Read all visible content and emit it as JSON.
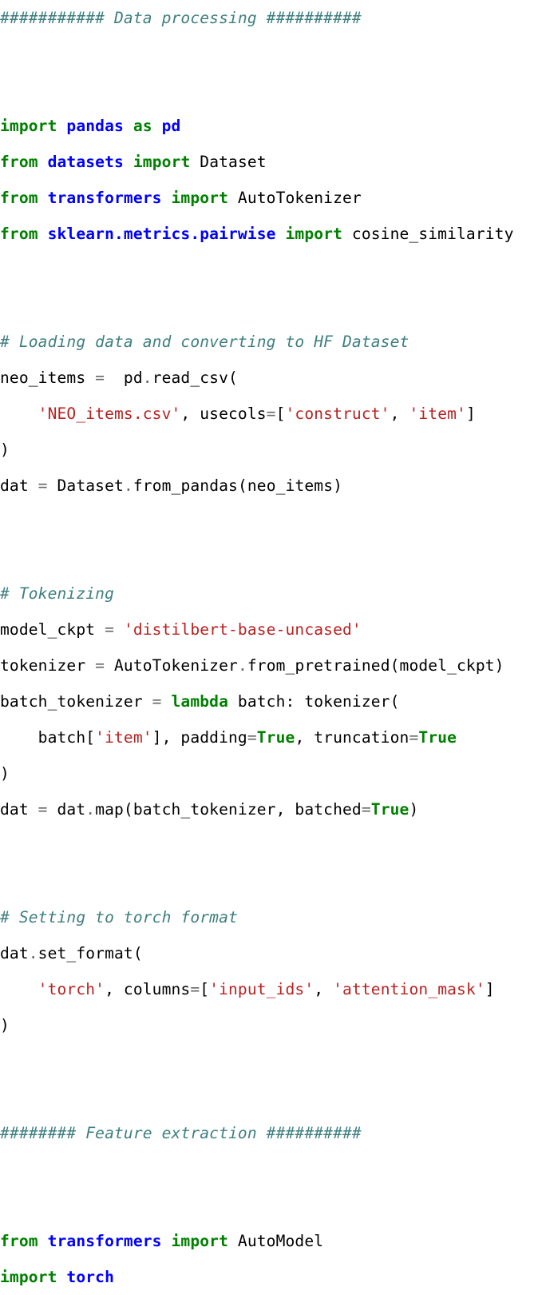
{
  "document": {
    "kind": "python-source-listing",
    "language": "Python",
    "background_color": "#ffffff",
    "default_text_color": "#000000"
  },
  "theme": {
    "comment_color": "#3f7f7f",
    "keyword_color": "#008000",
    "builtin_color": "#008000",
    "module_color": "#0000ff",
    "string_color": "#ba2121",
    "operator_color": "#666666",
    "plain_color": "#000000"
  },
  "sections": [
    {
      "id": "data-processing",
      "heading": "########### Data processing ##########"
    },
    {
      "id": "feature-extraction",
      "heading": "######## Feature extraction ##########"
    }
  ],
  "lines": [
    {
      "id": "l1",
      "kind": "comment",
      "tokens": [
        {
          "t": "comment",
          "v": "########### Data processing ##########"
        }
      ]
    },
    {
      "id": "l2",
      "kind": "blank",
      "tokens": []
    },
    {
      "id": "l3",
      "kind": "blank",
      "tokens": []
    },
    {
      "id": "l4",
      "kind": "code",
      "tokens": [
        {
          "t": "keyword",
          "v": "import"
        },
        {
          "t": "plain",
          "v": " "
        },
        {
          "t": "module",
          "v": "pandas"
        },
        {
          "t": "plain",
          "v": " "
        },
        {
          "t": "keyword",
          "v": "as"
        },
        {
          "t": "plain",
          "v": " "
        },
        {
          "t": "module",
          "v": "pd"
        }
      ]
    },
    {
      "id": "l5",
      "kind": "code",
      "tokens": [
        {
          "t": "keyword",
          "v": "from"
        },
        {
          "t": "plain",
          "v": " "
        },
        {
          "t": "module",
          "v": "datasets"
        },
        {
          "t": "plain",
          "v": " "
        },
        {
          "t": "keyword",
          "v": "import"
        },
        {
          "t": "plain",
          "v": " Dataset"
        }
      ]
    },
    {
      "id": "l6",
      "kind": "code",
      "tokens": [
        {
          "t": "keyword",
          "v": "from"
        },
        {
          "t": "plain",
          "v": " "
        },
        {
          "t": "module",
          "v": "transformers"
        },
        {
          "t": "plain",
          "v": " "
        },
        {
          "t": "keyword",
          "v": "import"
        },
        {
          "t": "plain",
          "v": " AutoTokenizer"
        }
      ]
    },
    {
      "id": "l7",
      "kind": "code",
      "tokens": [
        {
          "t": "keyword",
          "v": "from"
        },
        {
          "t": "plain",
          "v": " "
        },
        {
          "t": "module",
          "v": "sklearn.metrics.pairwise"
        },
        {
          "t": "plain",
          "v": " "
        },
        {
          "t": "keyword",
          "v": "import"
        },
        {
          "t": "plain",
          "v": " cosine_similarity"
        }
      ]
    },
    {
      "id": "l8",
      "kind": "blank",
      "tokens": []
    },
    {
      "id": "l9",
      "kind": "blank",
      "tokens": []
    },
    {
      "id": "l10",
      "kind": "comment",
      "tokens": [
        {
          "t": "comment",
          "v": "# Loading data and converting to HF Dataset"
        }
      ]
    },
    {
      "id": "l11",
      "kind": "code",
      "tokens": [
        {
          "t": "plain",
          "v": "neo_items "
        },
        {
          "t": "operator",
          "v": "="
        },
        {
          "t": "plain",
          "v": "  pd"
        },
        {
          "t": "operator",
          "v": "."
        },
        {
          "t": "plain",
          "v": "read_csv("
        }
      ]
    },
    {
      "id": "l12",
      "kind": "code",
      "tokens": [
        {
          "t": "plain",
          "v": "    "
        },
        {
          "t": "string",
          "v": "'NEO_items.csv'"
        },
        {
          "t": "plain",
          "v": ", usecols"
        },
        {
          "t": "operator",
          "v": "="
        },
        {
          "t": "plain",
          "v": "["
        },
        {
          "t": "string",
          "v": "'construct'"
        },
        {
          "t": "plain",
          "v": ", "
        },
        {
          "t": "string",
          "v": "'item'"
        },
        {
          "t": "plain",
          "v": "]"
        }
      ]
    },
    {
      "id": "l13",
      "kind": "code",
      "tokens": [
        {
          "t": "plain",
          "v": ")"
        }
      ]
    },
    {
      "id": "l14",
      "kind": "code",
      "tokens": [
        {
          "t": "plain",
          "v": "dat "
        },
        {
          "t": "operator",
          "v": "="
        },
        {
          "t": "plain",
          "v": " Dataset"
        },
        {
          "t": "operator",
          "v": "."
        },
        {
          "t": "plain",
          "v": "from_pandas(neo_items)"
        }
      ]
    },
    {
      "id": "l15",
      "kind": "blank",
      "tokens": []
    },
    {
      "id": "l16",
      "kind": "blank",
      "tokens": []
    },
    {
      "id": "l17",
      "kind": "comment",
      "tokens": [
        {
          "t": "comment",
          "v": "# Tokenizing"
        }
      ]
    },
    {
      "id": "l18",
      "kind": "code",
      "tokens": [
        {
          "t": "plain",
          "v": "model_ckpt "
        },
        {
          "t": "operator",
          "v": "="
        },
        {
          "t": "plain",
          "v": " "
        },
        {
          "t": "string",
          "v": "'distilbert-base-uncased'"
        }
      ]
    },
    {
      "id": "l19",
      "kind": "code",
      "tokens": [
        {
          "t": "plain",
          "v": "tokenizer "
        },
        {
          "t": "operator",
          "v": "="
        },
        {
          "t": "plain",
          "v": " AutoTokenizer"
        },
        {
          "t": "operator",
          "v": "."
        },
        {
          "t": "plain",
          "v": "from_pretrained(model_ckpt)"
        }
      ]
    },
    {
      "id": "l20",
      "kind": "code",
      "tokens": [
        {
          "t": "plain",
          "v": "batch_tokenizer "
        },
        {
          "t": "operator",
          "v": "="
        },
        {
          "t": "plain",
          "v": " "
        },
        {
          "t": "keyword",
          "v": "lambda"
        },
        {
          "t": "plain",
          "v": " batch: tokenizer("
        }
      ]
    },
    {
      "id": "l21",
      "kind": "code",
      "tokens": [
        {
          "t": "plain",
          "v": "    batch["
        },
        {
          "t": "string",
          "v": "'item'"
        },
        {
          "t": "plain",
          "v": "], padding"
        },
        {
          "t": "operator",
          "v": "="
        },
        {
          "t": "builtin",
          "v": "True"
        },
        {
          "t": "plain",
          "v": ", truncation"
        },
        {
          "t": "operator",
          "v": "="
        },
        {
          "t": "builtin",
          "v": "True"
        }
      ]
    },
    {
      "id": "l22",
      "kind": "code",
      "tokens": [
        {
          "t": "plain",
          "v": ")"
        }
      ]
    },
    {
      "id": "l23",
      "kind": "code",
      "tokens": [
        {
          "t": "plain",
          "v": "dat "
        },
        {
          "t": "operator",
          "v": "="
        },
        {
          "t": "plain",
          "v": " dat"
        },
        {
          "t": "operator",
          "v": "."
        },
        {
          "t": "plain",
          "v": "map(batch_tokenizer, batched"
        },
        {
          "t": "operator",
          "v": "="
        },
        {
          "t": "builtin",
          "v": "True"
        },
        {
          "t": "plain",
          "v": ")"
        }
      ]
    },
    {
      "id": "l24",
      "kind": "blank",
      "tokens": []
    },
    {
      "id": "l25",
      "kind": "blank",
      "tokens": []
    },
    {
      "id": "l26",
      "kind": "comment",
      "tokens": [
        {
          "t": "comment",
          "v": "# Setting to torch format"
        }
      ]
    },
    {
      "id": "l27",
      "kind": "code",
      "tokens": [
        {
          "t": "plain",
          "v": "dat"
        },
        {
          "t": "operator",
          "v": "."
        },
        {
          "t": "plain",
          "v": "set_format("
        }
      ]
    },
    {
      "id": "l28",
      "kind": "code",
      "tokens": [
        {
          "t": "plain",
          "v": "    "
        },
        {
          "t": "string",
          "v": "'torch'"
        },
        {
          "t": "plain",
          "v": ", columns"
        },
        {
          "t": "operator",
          "v": "="
        },
        {
          "t": "plain",
          "v": "["
        },
        {
          "t": "string",
          "v": "'input_ids'"
        },
        {
          "t": "plain",
          "v": ", "
        },
        {
          "t": "string",
          "v": "'attention_mask'"
        },
        {
          "t": "plain",
          "v": "]"
        }
      ]
    },
    {
      "id": "l29",
      "kind": "code",
      "tokens": [
        {
          "t": "plain",
          "v": ")"
        }
      ]
    },
    {
      "id": "l30",
      "kind": "blank",
      "tokens": []
    },
    {
      "id": "l31",
      "kind": "blank",
      "tokens": []
    },
    {
      "id": "l32",
      "kind": "comment",
      "tokens": [
        {
          "t": "comment",
          "v": "######## Feature extraction ##########"
        }
      ]
    },
    {
      "id": "l33",
      "kind": "blank",
      "tokens": []
    },
    {
      "id": "l34",
      "kind": "blank",
      "tokens": []
    },
    {
      "id": "l35",
      "kind": "code",
      "tokens": [
        {
          "t": "keyword",
          "v": "from"
        },
        {
          "t": "plain",
          "v": " "
        },
        {
          "t": "module",
          "v": "transformers"
        },
        {
          "t": "plain",
          "v": " "
        },
        {
          "t": "keyword",
          "v": "import"
        },
        {
          "t": "plain",
          "v": " AutoModel"
        }
      ]
    },
    {
      "id": "l36",
      "kind": "code",
      "tokens": [
        {
          "t": "keyword",
          "v": "import"
        },
        {
          "t": "plain",
          "v": " "
        },
        {
          "t": "module",
          "v": "torch"
        }
      ]
    }
  ]
}
